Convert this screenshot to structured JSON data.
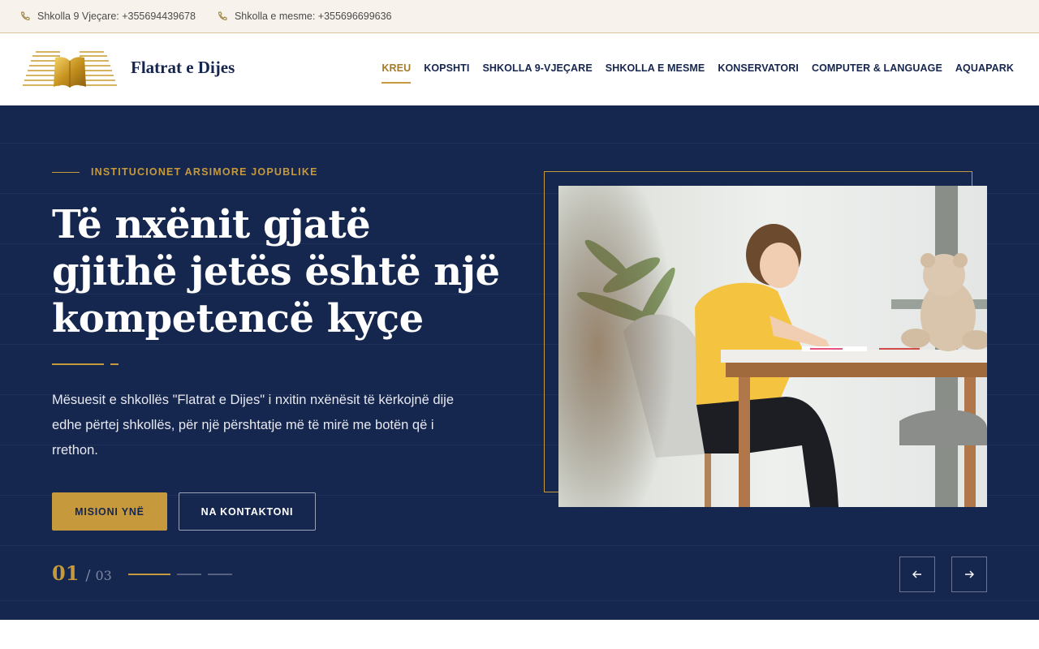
{
  "topbar": {
    "contacts": [
      {
        "icon": "phone-icon",
        "text": "Shkolla 9 Vjeçare: +355694439678"
      },
      {
        "icon": "phone-icon",
        "text": "Shkolla e mesme: +355696699636"
      }
    ]
  },
  "header": {
    "brand": "Flatrat e Dijes",
    "nav": [
      "KREU",
      "KOPSHTI",
      "SHKOLLA 9-VJEÇARE",
      "SHKOLLA E MESME",
      "KONSERVATORI",
      "COMPUTER & LANGUAGE",
      "AQUAPARK"
    ],
    "active_nav": "KREU"
  },
  "hero": {
    "eyebrow": "INSTITUCIONET ARSIMORE JOPUBLIKE",
    "headline": "Të nxënit gjatë gjithë jetës është një kompetencë kyçe",
    "lead": "Mësuesit e shkollës \"Flatrat e Dijes\" i nxitin nxënësit të kërkojnë dije edhe përtej shkollës, për një përshtatje më të mirë me botën që i rrethon.",
    "primary_button": "MISIONI YNË",
    "secondary_button": "NA KONTAKTONI",
    "slide_current": "01",
    "slide_separator": "/",
    "slide_total": "03",
    "active_slide": 1,
    "slide_count": 3
  },
  "colors": {
    "navy": "#15264f",
    "gold": "#c69a3c",
    "topbar_bg": "#f7f3ec"
  }
}
